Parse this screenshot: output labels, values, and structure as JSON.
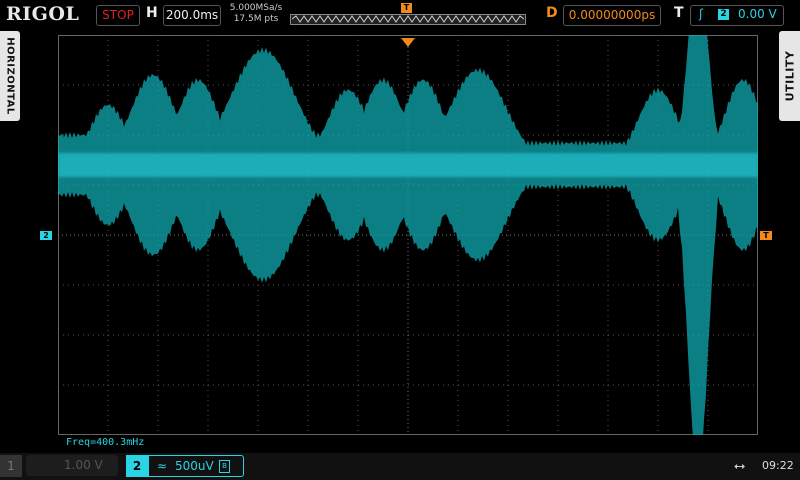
{
  "brand": "RIGOL",
  "status": "STOP",
  "horizontal": {
    "label": "H",
    "timebase": "200.0ms",
    "sample_rate": "5.000MSa/s",
    "memory_depth": "17.5M pts"
  },
  "trigger_marker": "T",
  "delay": {
    "label": "D",
    "value": "0.00000000ps"
  },
  "trigger": {
    "label": "T",
    "edge_icon": "rising-edge-icon",
    "source_channel": "2",
    "level": "0.00 V"
  },
  "side_tabs": {
    "left": "HORIZONTAL",
    "right": "UTILITY"
  },
  "screen": {
    "ch2_ref_marker": "2",
    "trigger_level_marker": "T",
    "frequency_readout": "Freq=400.3mHz"
  },
  "channels": [
    {
      "num": "1",
      "scale": "1.00 V",
      "active": false
    },
    {
      "num": "2",
      "scale": "500uV",
      "coupling_icon": "ac-coupling-icon",
      "bandwidth_limit_icon": "bw-limit-icon",
      "active": true
    }
  ],
  "clock": "09:22",
  "usb_icon": "usb-icon",
  "colors": {
    "ch2": "#2ad4e4",
    "trace": "#10a9b0",
    "trigger": "#f08a1c",
    "stop": "#dd2222"
  }
}
